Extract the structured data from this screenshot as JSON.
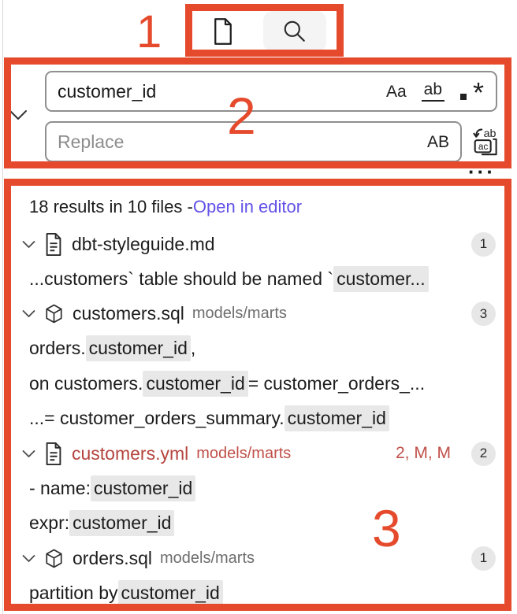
{
  "annotation": {
    "label1": "1",
    "label2": "2",
    "label3": "3"
  },
  "colors": {
    "annotation_red": "#e54a2c",
    "link_purple": "#6252e8",
    "modified_file_red": "#b5443e",
    "git_status_red": "#c0504a",
    "match_highlight_bg": "#e8e8e8",
    "badge_bg": "#e7e7e7",
    "active_tab_bg": "#f4f4f5"
  },
  "search": {
    "query": "customer_id",
    "replace_placeholder": "Replace",
    "match_case_label": "Aa",
    "whole_word_label": "ab",
    "regex_label": "*",
    "preserve_case_label": "AB",
    "more_actions_label": "···"
  },
  "results": {
    "summary": "18 results in 10 files - ",
    "open_in_editor": "Open in editor",
    "files": [
      {
        "icon": "file",
        "name": "dbt-styleguide.md",
        "path": "",
        "badge": "1",
        "modified": false,
        "matches": [
          [
            {
              "t": "...customers` table should be named `"
            },
            {
              "t": "customer...",
              "h": true
            }
          ]
        ]
      },
      {
        "icon": "cube",
        "name": "customers.sql",
        "path": "models/marts",
        "badge": "3",
        "modified": false,
        "matches": [
          [
            {
              "t": "orders."
            },
            {
              "t": "customer_id",
              "h": true
            },
            {
              "t": ","
            }
          ],
          [
            {
              "t": "on customers."
            },
            {
              "t": "customer_id",
              "h": true
            },
            {
              "t": " = customer_orders_..."
            }
          ],
          [
            {
              "t": "...= customer_orders_summary."
            },
            {
              "t": "customer_id",
              "h": true
            }
          ]
        ]
      },
      {
        "icon": "file",
        "name": "customers.yml",
        "path": "models/marts",
        "badge": "2",
        "modified": true,
        "git_status": "2, M, M",
        "matches": [
          [
            {
              "t": "- name: "
            },
            {
              "t": "customer_id",
              "h": true
            }
          ],
          [
            {
              "t": "expr: "
            },
            {
              "t": "customer_id",
              "h": true
            }
          ]
        ]
      },
      {
        "icon": "cube",
        "name": "orders.sql",
        "path": "models/marts",
        "badge": "1",
        "modified": false,
        "matches": [
          [
            {
              "t": "partition by "
            },
            {
              "t": "customer_id",
              "h": true
            }
          ]
        ]
      }
    ]
  }
}
